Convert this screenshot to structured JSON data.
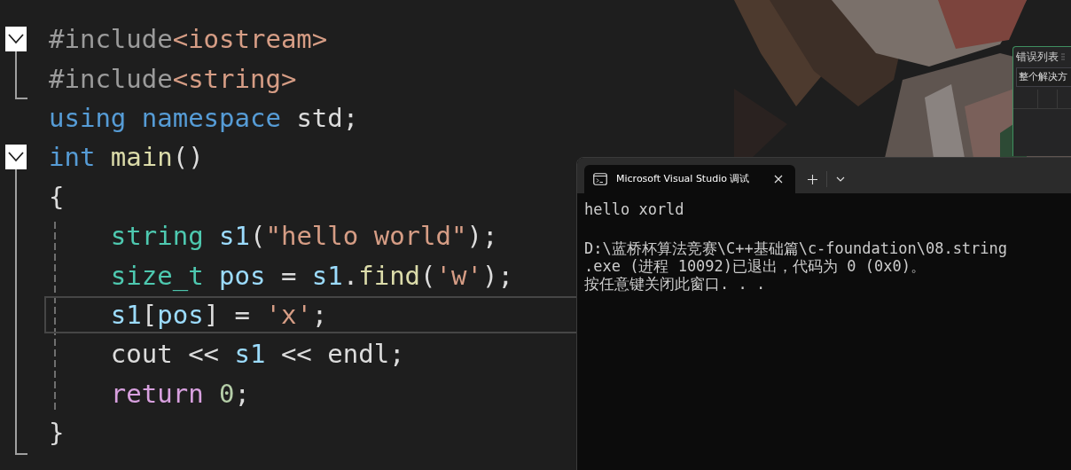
{
  "editor": {
    "lines": [
      {
        "tokens": [
          {
            "text": "#include",
            "kind": "directive"
          },
          {
            "text": "<iostream>",
            "kind": "string"
          }
        ],
        "fold": {
          "expanded": true
        },
        "current": false
      },
      {
        "tokens": [
          {
            "text": "#include",
            "kind": "directive"
          },
          {
            "text": "<string>",
            "kind": "string"
          }
        ],
        "current": false
      },
      {
        "tokens": [
          {
            "text": "using",
            "kind": "keyword"
          },
          {
            "text": " namespace",
            "kind": "keyword"
          },
          {
            "text": " std;",
            "kind": "plain"
          }
        ],
        "current": false
      },
      {
        "tokens": [
          {
            "text": "int",
            "kind": "keyword"
          },
          {
            "text": " main",
            "kind": "function"
          },
          {
            "text": "()",
            "kind": "plain"
          }
        ],
        "fold": {
          "expanded": true
        },
        "current": false
      },
      {
        "tokens": [
          {
            "text": "{",
            "kind": "plain"
          }
        ],
        "current": false
      },
      {
        "tokens": [
          {
            "text": "    string",
            "kind": "type"
          },
          {
            "text": " s1",
            "kind": "variable"
          },
          {
            "text": "(",
            "kind": "plain"
          },
          {
            "text": "\"hello world\"",
            "kind": "string"
          },
          {
            "text": ");",
            "kind": "plain"
          }
        ],
        "current": false
      },
      {
        "tokens": [
          {
            "text": "    size_t",
            "kind": "type"
          },
          {
            "text": " pos",
            "kind": "variable"
          },
          {
            "text": " = ",
            "kind": "plain"
          },
          {
            "text": "s1",
            "kind": "variable"
          },
          {
            "text": ".",
            "kind": "plain"
          },
          {
            "text": "find",
            "kind": "function"
          },
          {
            "text": "(",
            "kind": "plain"
          },
          {
            "text": "'w'",
            "kind": "string"
          },
          {
            "text": ");",
            "kind": "plain"
          }
        ],
        "current": false
      },
      {
        "tokens": [
          {
            "text": "    s1",
            "kind": "variable"
          },
          {
            "text": "[",
            "kind": "plain"
          },
          {
            "text": "pos",
            "kind": "variable"
          },
          {
            "text": "] = ",
            "kind": "plain"
          },
          {
            "text": "'x'",
            "kind": "string"
          },
          {
            "text": ";",
            "kind": "plain"
          }
        ],
        "current": true
      },
      {
        "tokens": [
          {
            "text": "    cout << ",
            "kind": "plain"
          },
          {
            "text": "s1",
            "kind": "variable"
          },
          {
            "text": " << endl;",
            "kind": "plain"
          }
        ],
        "current": false
      },
      {
        "tokens": [
          {
            "text": "    return",
            "kind": "control"
          },
          {
            "text": " 0",
            "kind": "number"
          },
          {
            "text": ";",
            "kind": "plain"
          }
        ],
        "current": false
      },
      {
        "tokens": [
          {
            "text": "}",
            "kind": "plain"
          }
        ],
        "current": false
      }
    ]
  },
  "error_list": {
    "title": "错误列表",
    "scope": "整个解决方"
  },
  "console": {
    "tab": {
      "title": "Microsoft Visual Studio 调试",
      "selected": true
    },
    "output": [
      "hello xorld"
    ],
    "messages": [
      "D:\\蓝桥杯算法竞赛\\C++基础篇\\c-foundation\\08.string",
      ".exe (进程 10092)已退出，代码为 0 (0x0)。",
      "按任意键关闭此窗口. . ."
    ]
  }
}
